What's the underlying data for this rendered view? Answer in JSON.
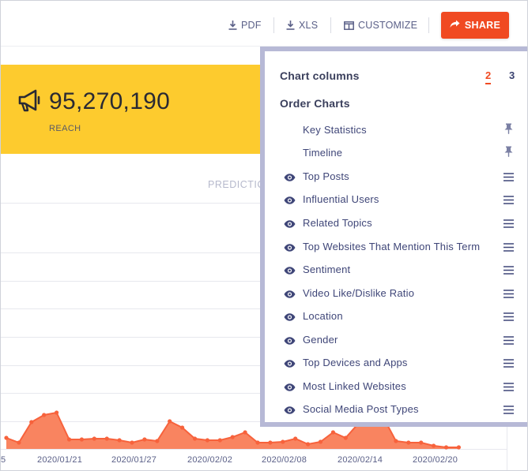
{
  "toolbar": {
    "pdf_label": "PDF",
    "xls_label": "XLS",
    "customize_label": "CUSTOMIZE",
    "share_label": "SHARE"
  },
  "reach": {
    "value": "95,270,190",
    "label": "REACH"
  },
  "chart": {
    "prediction_label": "PREDICTIO",
    "x_labels": [
      "5",
      "2020/01/21",
      "2020/01/27",
      "2020/02/02",
      "2020/02/08",
      "2020/02/14",
      "2020/02/20"
    ],
    "series_color": "#f7623c",
    "fill_color": "#f98460"
  },
  "chart_data": {
    "type": "area",
    "x": [
      "2020/01/15",
      "2020/01/16",
      "2020/01/17",
      "2020/01/18",
      "2020/01/19",
      "2020/01/20",
      "2020/01/21",
      "2020/01/22",
      "2020/01/23",
      "2020/01/24",
      "2020/01/25",
      "2020/01/26",
      "2020/01/27",
      "2020/01/28",
      "2020/01/29",
      "2020/01/30",
      "2020/01/31",
      "2020/02/01",
      "2020/02/02",
      "2020/02/03",
      "2020/02/04",
      "2020/02/05",
      "2020/02/06",
      "2020/02/07",
      "2020/02/08",
      "2020/02/09",
      "2020/02/10",
      "2020/02/11",
      "2020/02/12",
      "2020/02/13",
      "2020/02/14",
      "2020/02/15",
      "2020/02/16",
      "2020/02/17",
      "2020/02/18",
      "2020/02/19",
      "2020/02/20"
    ],
    "values": [
      14,
      8,
      34,
      43,
      46,
      12,
      12,
      13,
      13,
      11,
      8,
      12,
      10,
      35,
      27,
      13,
      11,
      11,
      15,
      21,
      8,
      8,
      9,
      13,
      6,
      9,
      21,
      14,
      32,
      47,
      40,
      10,
      8,
      8,
      4,
      2,
      2
    ],
    "xlabel": "",
    "ylabel": "",
    "grid": true
  },
  "panel": {
    "chart_columns_label": "Chart columns",
    "column_options": [
      "2",
      "3"
    ],
    "active_column": "2",
    "order_charts_label": "Order Charts",
    "items": [
      {
        "label": "Key Statistics",
        "pinned": true
      },
      {
        "label": "Timeline",
        "pinned": true
      },
      {
        "label": "Top Posts",
        "pinned": false
      },
      {
        "label": "Influential Users",
        "pinned": false
      },
      {
        "label": "Related Topics",
        "pinned": false
      },
      {
        "label": "Top Websites That Mention This Term",
        "pinned": false
      },
      {
        "label": "Sentiment",
        "pinned": false
      },
      {
        "label": "Video Like/Dislike Ratio",
        "pinned": false
      },
      {
        "label": "Location",
        "pinned": false
      },
      {
        "label": "Gender",
        "pinned": false
      },
      {
        "label": "Top Devices and Apps",
        "pinned": false
      },
      {
        "label": "Most Linked Websites",
        "pinned": false
      },
      {
        "label": "Social Media Post Types",
        "pinned": false
      }
    ]
  },
  "colors": {
    "accent": "#f04a22",
    "reach_card": "#fdcb2e",
    "panel_border": "#b7b9d6",
    "text_primary": "#3a3f5c",
    "text_item": "#3f4678"
  }
}
